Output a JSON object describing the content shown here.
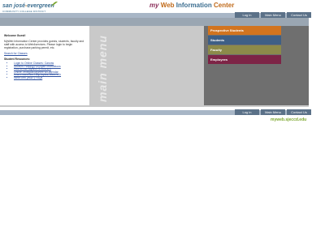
{
  "logo": {
    "name_left": "san josé",
    "name_dash": "-",
    "name_right": "evergreen",
    "subtitle": "COMMUNITY COLLEGE DISTRICT"
  },
  "site_title": {
    "my": "my",
    "web": "Web",
    "information": "Information",
    "center": "Center"
  },
  "top_nav": {
    "login": "Log in",
    "main_menu": "Main Menu",
    "contact": "Contact Us"
  },
  "main": {
    "welcome": "Welcome Guest!",
    "intro": "MyWeb Information Center provides guests, students, faculty and staff with access to Web4services. Please login to begin registration, purchase parking permit, etc.",
    "search_link": "Search for Classes",
    "student_resources_title": "Student Resources:",
    "student_resources": [
      "Login to Online Classes: Canvas",
      "Student Parking/Purchase Instructions",
      "How to use MyWeb 3 Courses",
      "Online Textbook/MyWeb w/Calendar",
      "Learn more/See Help topics, More info",
      "WebForm (W&P) FAQs"
    ],
    "watermark": "main menu"
  },
  "side_nav": [
    {
      "label": "Prospective Students",
      "color": "#d2741f"
    },
    {
      "label": "Students",
      "color": "#3e5f86"
    },
    {
      "label": "Faculty",
      "color": "#8c8a4a"
    },
    {
      "label": "Employees",
      "color": "#7d2446"
    }
  ],
  "bottom_nav": {
    "login": "Log in",
    "main_menu": "Main Menu",
    "contact": "Contact Us"
  },
  "footer": {
    "url": "myweb.sjeccd.edu"
  }
}
